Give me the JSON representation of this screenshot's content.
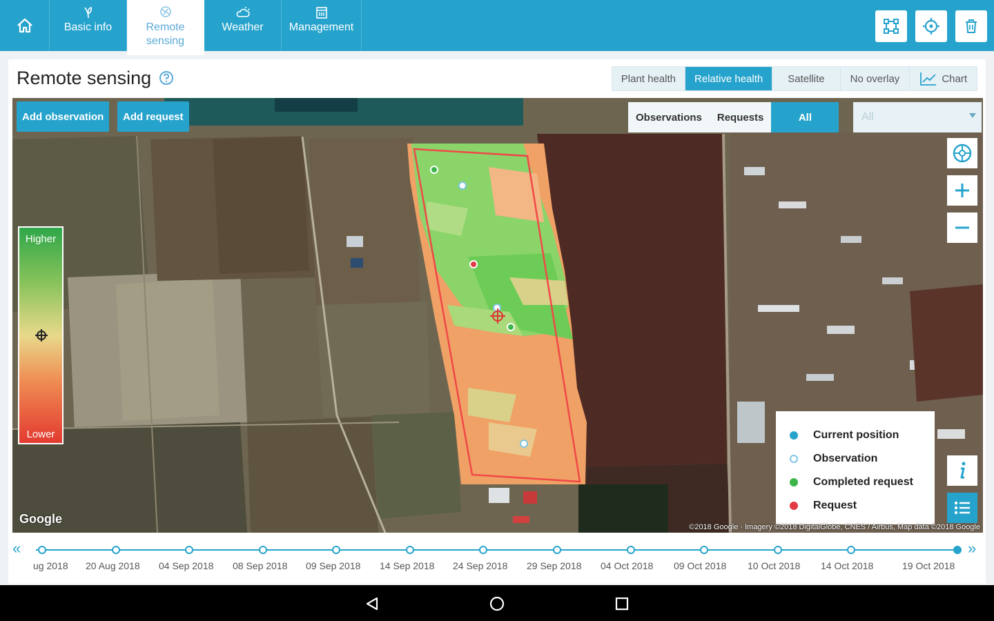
{
  "nav": {
    "tabs": [
      {
        "label": "Basic info",
        "icon": "leaf-icon"
      },
      {
        "label": "Remote sensing",
        "icon": "satellite-icon"
      },
      {
        "label": "Weather",
        "icon": "cloud-sun-icon"
      },
      {
        "label": "Management",
        "icon": "calendar-icon"
      }
    ],
    "active_tab": "Remote sensing"
  },
  "page": {
    "title": "Remote sensing"
  },
  "overlay_options": [
    "Plant health",
    "Relative health",
    "Satellite",
    "No overlay",
    "Chart"
  ],
  "overlay_active": "Relative health",
  "map": {
    "add_observation": "Add observation",
    "add_request": "Add request",
    "filters": [
      "Observations",
      "Requests",
      "All"
    ],
    "filter_active": "All",
    "dropdown_value": "All",
    "legend_scale": {
      "high": "Higher",
      "low": "Lower"
    },
    "legend": [
      {
        "label": "Current position",
        "color": "#26a3cc",
        "style": "filled"
      },
      {
        "label": "Observation",
        "color": "#7cc6e6",
        "style": "hollow"
      },
      {
        "label": "Completed request",
        "color": "#3cb54a",
        "style": "filled"
      },
      {
        "label": "Request",
        "color": "#e23a44",
        "style": "filled"
      }
    ],
    "google_label": "Google",
    "attribution": "©2018 Google · Imagery ©2018 DigitalGlobe, CNES / Airbus, Map data ©2018 Google"
  },
  "timeline": {
    "dates": [
      "ug 2018",
      "20 Aug 2018",
      "04 Sep 2018",
      "08 Sep 2018",
      "09 Sep 2018",
      "14 Sep 2018",
      "24 Sep 2018",
      "29 Sep 2018",
      "04 Oct 2018",
      "09 Oct 2018",
      "10 Oct 2018",
      "14 Oct 2018",
      "19 Oct 2018"
    ],
    "selected": "19 Oct 2018"
  },
  "colors": {
    "brand": "#26a3cc",
    "high": "#2fa74a",
    "low": "#e23a30"
  }
}
